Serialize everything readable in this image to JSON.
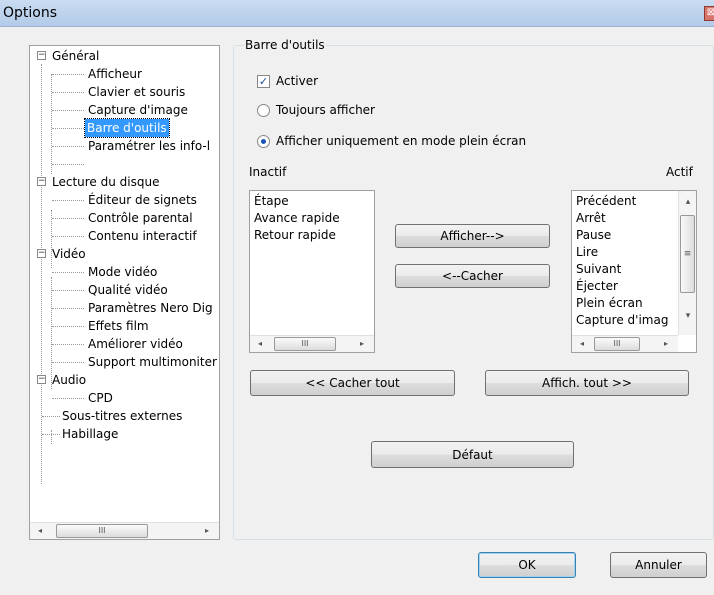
{
  "window": {
    "title": "Options",
    "close_glyph": "⊠"
  },
  "tree": {
    "items": [
      {
        "label": "Général",
        "level": 0,
        "expanded": true
      },
      {
        "label": "Afficheur",
        "level": 1
      },
      {
        "label": "Clavier et souris",
        "level": 1
      },
      {
        "label": "Capture d'image",
        "level": 1
      },
      {
        "label": "Barre d'outils",
        "level": 1,
        "selected": true
      },
      {
        "label": "Paramétrer les info-l",
        "level": 1
      },
      {
        "label": "Lecture du disque",
        "level": 0,
        "expanded": true
      },
      {
        "label": "Éditeur de signets",
        "level": 1
      },
      {
        "label": "Contrôle parental",
        "level": 1
      },
      {
        "label": "Contenu interactif",
        "level": 1
      },
      {
        "label": "Vidéo",
        "level": 0,
        "expanded": true
      },
      {
        "label": "Mode vidéo",
        "level": 1
      },
      {
        "label": "Qualité vidéo",
        "level": 1
      },
      {
        "label": "Paramètres Nero Dig",
        "level": 1
      },
      {
        "label": "Effets film",
        "level": 1
      },
      {
        "label": "Améliorer vidéo",
        "level": 1
      },
      {
        "label": "Support multimoniter",
        "level": 1
      },
      {
        "label": "Audio",
        "level": 0,
        "expanded": true
      },
      {
        "label": "CPD",
        "level": 1
      },
      {
        "label": "Sous-titres externes",
        "level": 0
      },
      {
        "label": "Habillage",
        "level": 0
      }
    ]
  },
  "toolbar_group": {
    "title": "Barre d'outils",
    "activate": {
      "label": "Activer",
      "checked": true
    },
    "always_show": {
      "label": "Toujours afficher",
      "selected": false
    },
    "fullscreen_only": {
      "label": "Afficher uniquement en mode plein écran",
      "selected": true
    }
  },
  "inactive": {
    "label": "Inactif",
    "items": [
      "Étape",
      "Avance rapide",
      "Retour rapide"
    ]
  },
  "active": {
    "label": "Actif",
    "items": [
      "Précédent",
      "Arrêt",
      "Pause",
      "Lire",
      "Suivant",
      "Éjecter",
      "Plein écran",
      "Capture d'imag"
    ]
  },
  "buttons": {
    "show": "Afficher-->",
    "hide": "<--Cacher",
    "hide_all": "<< Cacher tout",
    "show_all": "Affich. tout >>",
    "default": "Défaut",
    "ok": "OK",
    "cancel": "Annuler"
  },
  "scroll_glyphs": {
    "left": "◂",
    "right": "▸",
    "up": "▴",
    "down": "▾",
    "grip_h": "III",
    "grip_v": "≡"
  }
}
